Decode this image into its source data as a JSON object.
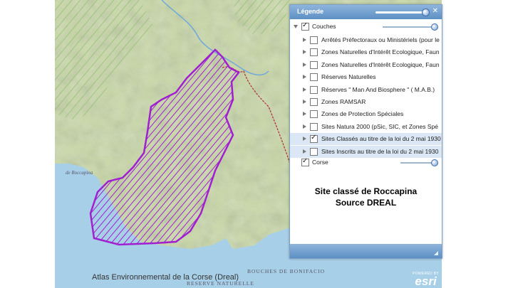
{
  "map": {
    "credit_left": "Atlas Environnemental de la Corse (Dreal)",
    "place_labels": [
      "RESERVE NATURELLE",
      "BOUCHES DE BONIFACIO"
    ],
    "esri_powered": "POWERED BY",
    "esri_brand": "esri",
    "sea_color": "#a8cfe8",
    "land_color": "#c9d8a8",
    "site_color": "#a020d0"
  },
  "legend": {
    "title": "Légende",
    "close_icon": "✕",
    "root_label": "Couches",
    "layers": [
      {
        "label": "Arrêtés Préfectoraux ou Ministériels (pour le",
        "checked": false
      },
      {
        "label": "Zones Naturelles d'Intérêt Ecologique, Faun",
        "checked": false
      },
      {
        "label": "Zones Naturelles d'Intérêt Ecologique, Faun",
        "checked": false
      },
      {
        "label": "Réserves Naturelles",
        "checked": false
      },
      {
        "label": "Réserves \" Man And Biosphere \" ( M.A.B.)",
        "checked": false
      },
      {
        "label": "Zones RAMSAR",
        "checked": false
      },
      {
        "label": "Zones de Protection Spéciales",
        "checked": false
      },
      {
        "label": "Sites Natura 2000 (pSic, SIC, et Zones Spé",
        "checked": false
      },
      {
        "label": "Sites Classés au titre de la loi du 2 mai 1930",
        "checked": true
      },
      {
        "label": "Sites Inscrits au titre de la loi du 2 mai 1930",
        "checked": false
      }
    ],
    "corse_label": "Corse",
    "caption_line1": "Site classé de Roccapina",
    "caption_line2": "Source DREAL"
  }
}
